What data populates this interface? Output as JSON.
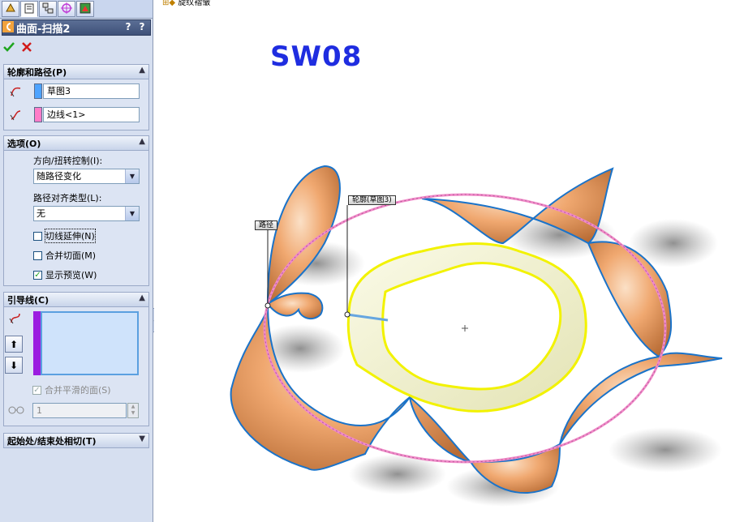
{
  "panel": {
    "title": "曲面-扫描2",
    "title_buttons": [
      "?",
      "?"
    ],
    "tabs": [
      "feature-manager-icon",
      "property-manager-icon",
      "configuration-manager-icon",
      "dimxpert-icon",
      "display-manager-icon"
    ],
    "ok_icon": "checkmark-icon",
    "cancel_icon": "x-icon"
  },
  "profile_path": {
    "title": "轮廓和路径(P)",
    "profile_value": "草图3",
    "path_value": "边线<1>",
    "profile_color": "#4da3ff",
    "path_color": "#ff7cc8"
  },
  "options": {
    "title": "选项(O)",
    "orientation_label": "方向/扭转控制(I):",
    "orientation_value": "随路径变化",
    "alignment_label": "路径对齐类型(L):",
    "alignment_value": "无",
    "tangent_extension": "切线延伸(N)",
    "merge_tangent_faces": "合并切面(M)",
    "show_preview": "显示预览(W)"
  },
  "guide_curves": {
    "title": "引导线(C)",
    "merge_smooth_faces": "合并平滑的面(S)",
    "spin_value": "1",
    "list_color": "#9b1de0"
  },
  "start_end_tangency": {
    "title": "起始处/结束处相切(T)"
  },
  "viewport": {
    "part_name": "旋纹褶皱",
    "watermark": "SW08",
    "callout_profile": "轮廓(草图3)",
    "callout_path": "路径"
  }
}
